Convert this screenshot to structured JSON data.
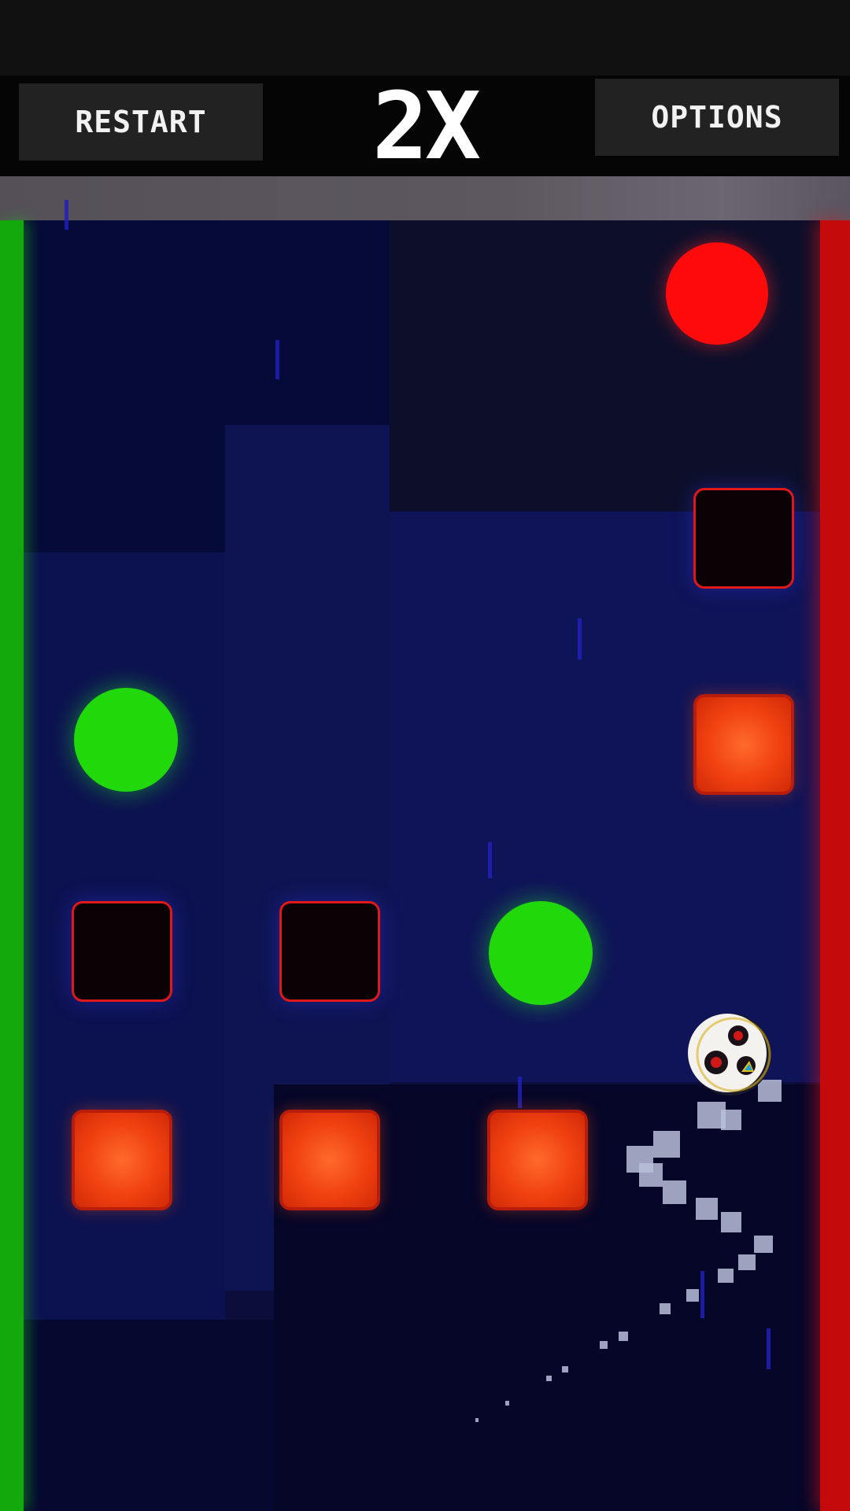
{
  "hud": {
    "restart_label": "RESTART",
    "multiplier": "2X",
    "options_label": "OPTIONS"
  },
  "colors": {
    "left_wall": "#13a80c",
    "right_wall": "#c40a0a",
    "field": "#0b0d3a",
    "ceiling": "#5d5860",
    "target_orb_red": "#ff0a0a",
    "bonus_orb_green": "#20d80a",
    "solid_block": "#f04010",
    "hollow_block_border": "#e01818"
  },
  "icons": {
    "player": "skull-ball-icon"
  }
}
